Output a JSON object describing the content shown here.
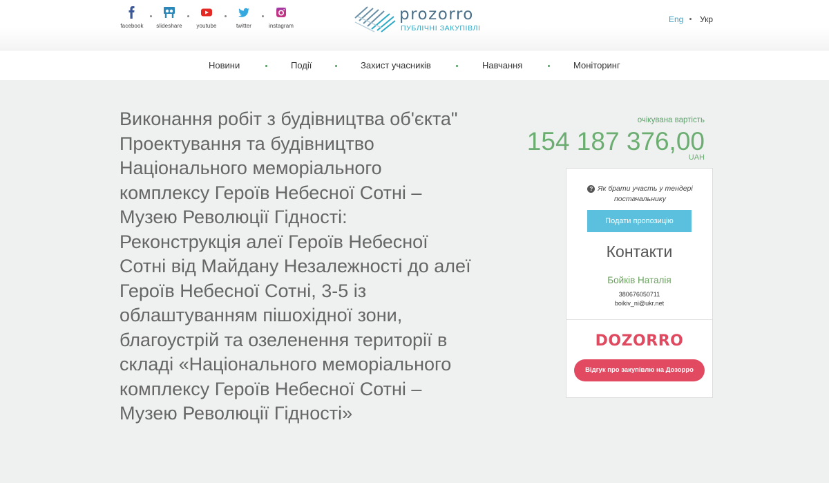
{
  "header": {
    "socials": [
      {
        "label": "facebook",
        "icon": "facebook-icon",
        "color": "#3b5998"
      },
      {
        "label": "slideshare",
        "icon": "slideshare-icon",
        "color": "#2c88b9"
      },
      {
        "label": "youtube",
        "icon": "youtube-icon",
        "color": "#e32a24"
      },
      {
        "label": "twitter",
        "icon": "twitter-icon",
        "color": "#35a8e0"
      },
      {
        "label": "instagram",
        "icon": "instagram-icon",
        "color": "#c13584"
      }
    ],
    "logo": {
      "name": "prozorro",
      "subtitle": "ПУБЛІЧНІ ЗАКУПІВЛІ"
    },
    "lang": {
      "en": "Eng",
      "uk": "Укр"
    }
  },
  "nav": {
    "items": [
      "Новини",
      "Події",
      "Захист учасників",
      "Навчання",
      "Моніторинг"
    ]
  },
  "tender": {
    "title": "Виконання робіт з будівництва об'єкта\" Проектування та будівництво Національного меморіального комплексу Героїв Небесної Сотні – Музею Революції Гідності: Реконструкція алеї Героїв Небесної Сотні від Майдану Незалежності до алеї Героїв Небесної Сотні, 3-5 із облаштуванням пішохідної зони, благоустрій та озеленення території в складі «Національного меморіального комплексу Героїв Небесної Сотні – Музею Революції Гідності»",
    "value_label": "очікувана вартість",
    "value_amount": "154 187 376,00",
    "currency": "UAH"
  },
  "card": {
    "howto": "Як брати участь у тендері постачальнику",
    "offer_button": "Подати пропозицію",
    "contacts_title": "Контакти",
    "contact_name": "Бойків Наталія",
    "contact_phone": "380676050711",
    "contact_email": "boikiv_ni@ukr.net",
    "dozorro_logo": "DOZORRO",
    "dozorro_button": "Відгук про закупівлю на Дозорро"
  },
  "colors": {
    "accent_green": "#6cae72",
    "button_blue": "#5bc0de",
    "dozorro_red": "#e24a61",
    "page_bg": "#eef1ef"
  }
}
